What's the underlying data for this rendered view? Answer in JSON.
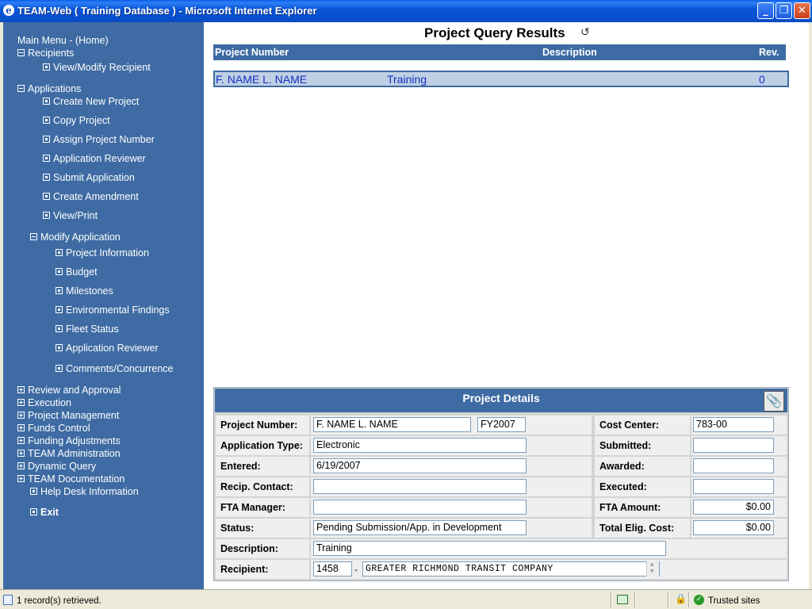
{
  "window": {
    "title": "TEAM-Web ( Training Database ) - Microsoft Internet Explorer",
    "ie_icon": "e",
    "min_glyph": "_",
    "max_glyph": "❐",
    "close_glyph": "✕"
  },
  "sidebar": {
    "main_menu": "Main Menu - (Home)",
    "recipients": "Recipients",
    "view_modify_recipient": "View/Modify Recipient",
    "applications": "Applications",
    "app_items": [
      "Create New Project",
      "Copy Project",
      "Assign Project Number",
      "Application Reviewer",
      "Submit Application",
      "Create Amendment",
      "View/Print"
    ],
    "modify_application": "Modify Application",
    "modify_items": [
      "Project Information",
      "Budget",
      "Milestones",
      "Environmental Findings",
      "Fleet Status",
      "Application Reviewer",
      "Comments/Concurrence"
    ],
    "bottom_items": [
      "Review and Approval",
      "Execution",
      "Project Management",
      "Funds Control",
      "Funding Adjustments",
      "TEAM Administration",
      "Dynamic Query",
      "TEAM Documentation"
    ],
    "help_desk": "Help Desk Information",
    "exit": "Exit"
  },
  "results": {
    "title": "Project Query Results",
    "refresh_glyph": "↺",
    "columns": {
      "project_number": "Project Number",
      "description": "Description",
      "rev": "Rev."
    },
    "row": {
      "project_number": "F. NAME L. NAME",
      "description": "Training",
      "rev": "0"
    }
  },
  "details": {
    "title": "Project Details",
    "clip_glyph": "📎",
    "project_number_label": "Project Number:",
    "project_number": "F. NAME L. NAME",
    "fiscal_year": "FY2007",
    "application_type_label": "Application Type:",
    "application_type": "Electronic",
    "entered_label": "Entered:",
    "entered": "6/19/2007",
    "recip_contact_label": "Recip. Contact:",
    "recip_contact": "",
    "fta_manager_label": "FTA Manager:",
    "fta_manager": "",
    "status_label": "Status:",
    "status": "Pending Submission/App. in Development",
    "description_label": "Description:",
    "description": "Training",
    "recipient_label": "Recipient:",
    "recipient_id": "1458",
    "recipient_dash": "-",
    "recipient_name": "GREATER RICHMOND TRANSIT COMPANY",
    "cost_center_label": "Cost Center:",
    "cost_center": "783-00",
    "submitted_label": "Submitted:",
    "submitted": "",
    "awarded_label": "Awarded:",
    "awarded": "",
    "executed_label": "Executed:",
    "executed": "",
    "fta_amount_label": "FTA Amount:",
    "fta_amount": "$0.00",
    "total_elig_cost_label": "Total Elig. Cost:",
    "total_elig_cost": "$0.00"
  },
  "statusbar": {
    "text": "1 record(s) retrieved.",
    "lock_glyph": "🔒",
    "zone_glyph": "✓",
    "zone": "Trusted sites"
  }
}
